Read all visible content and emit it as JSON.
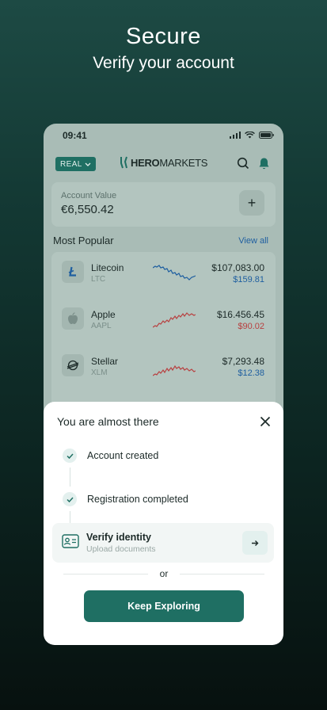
{
  "hero": {
    "title": "Secure",
    "subtitle": "Verify your account"
  },
  "phone": {
    "status_time": "09:41",
    "badge": "REAL",
    "logo": {
      "bold": "HERO",
      "light": "MARKETS"
    },
    "account": {
      "label": "Account Value",
      "value": "€6,550.42",
      "add": "+"
    },
    "section": {
      "title": "Most Popular",
      "link": "View all"
    },
    "assets": [
      {
        "name": "Litecoin",
        "ticker": "LTC",
        "price": "$107,083.00",
        "change": "$159.81",
        "trend": "down",
        "color": "#1f5fa0",
        "icon": "litecoin-icon"
      },
      {
        "name": "Apple",
        "ticker": "AAPL",
        "price": "$16.456.45",
        "change": "$90.02",
        "trend": "up",
        "color": "#b84040",
        "icon": "apple-icon"
      },
      {
        "name": "Stellar",
        "ticker": "XLM",
        "price": "$7,293.48",
        "change": "$12.38",
        "trend": "up",
        "color": "#1f5fa0",
        "icon": "stellar-icon"
      }
    ]
  },
  "sheet": {
    "title": "You are almost there",
    "steps": [
      {
        "label": "Account created",
        "status": "done"
      },
      {
        "label": "Registration completed",
        "status": "done"
      }
    ],
    "verify": {
      "title": "Verify identity",
      "subtitle": "Upload documents"
    },
    "or": "or",
    "cta": "Keep Exploring"
  },
  "colors": {
    "brand": "#1f6f63",
    "positive": "#1f5fa0",
    "negative": "#b84040"
  }
}
